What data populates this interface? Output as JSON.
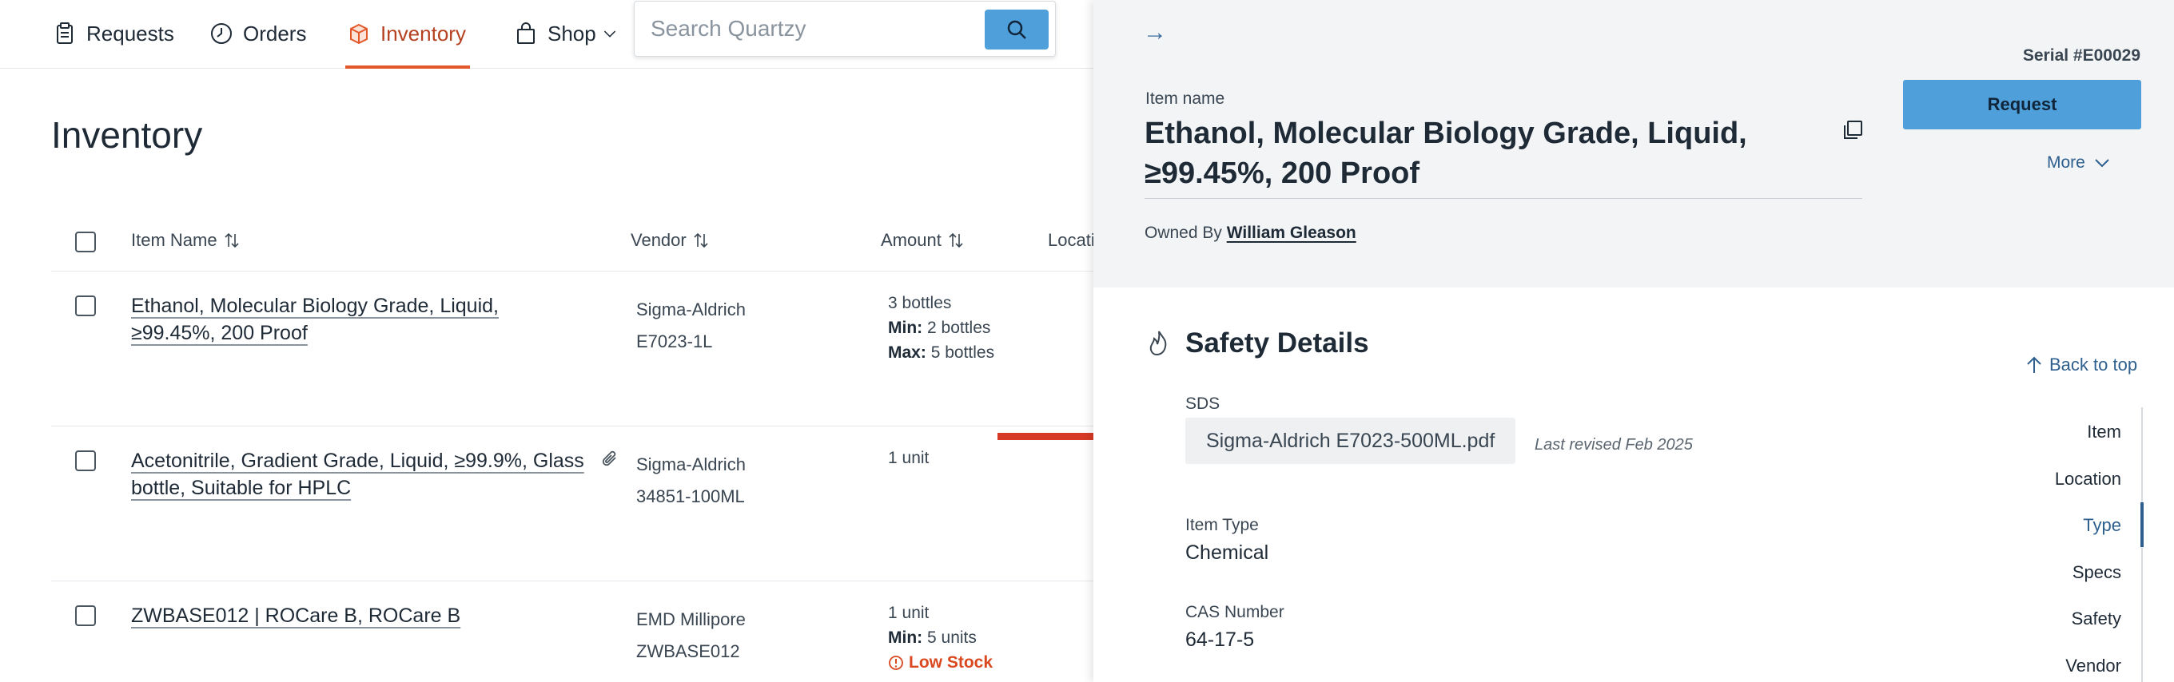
{
  "nav": {
    "items": [
      {
        "label": "Requests",
        "icon": "clipboard-icon"
      },
      {
        "label": "Orders",
        "icon": "clock-icon"
      },
      {
        "label": "Inventory",
        "icon": "box-icon"
      },
      {
        "label": "Shop",
        "icon": "shopping-bag-icon"
      }
    ],
    "active": "Inventory",
    "search_placeholder": "Search Quartzy"
  },
  "page": {
    "title": "Inventory"
  },
  "table": {
    "columns": [
      "Item Name",
      "Vendor",
      "Amount",
      "Locati"
    ],
    "rows": [
      {
        "name": "Ethanol, Molecular Biology Grade, Liquid, ≥99.45%, 200 Proof",
        "vendor": "Sigma-Aldrich",
        "catalog": "E7023-1L",
        "amount": "3 bottles",
        "min_label": "Min:",
        "min": "2 bottles",
        "max_label": "Max:",
        "max": "5 bottles"
      },
      {
        "name": "Acetonitrile, Gradient Grade, Liquid, ≥99.9%, Glass bottle, Suitable for HPLC",
        "vendor": "Sigma-Aldrich",
        "catalog": "34851-100ML",
        "amount": "1 unit",
        "has_attachment": true
      },
      {
        "name": "ZWBASE012 | ROCare B, ROCare B",
        "vendor": "EMD Millipore",
        "catalog": "ZWBASE012",
        "amount": "1 unit",
        "min_label": "Min:",
        "min": "5 units",
        "status": "Low Stock"
      }
    ]
  },
  "panel": {
    "serial": "Serial #E00029",
    "request_label": "Request",
    "more_label": "More",
    "item_name_label": "Item name",
    "item_name": "Ethanol, Molecular Biology Grade, Liquid, ≥99.45%, 200 Proof",
    "owned_by_label": "Owned By",
    "owner": "William Gleason",
    "safety_title": "Safety Details",
    "back_to_top": "Back to top",
    "sds_label": "SDS",
    "sds_file": "Sigma-Aldrich E7023-500ML.pdf",
    "sds_revised": "Last revised Feb 2025",
    "item_type_label": "Item Type",
    "item_type": "Chemical",
    "cas_label": "CAS Number",
    "cas": "64-17-5",
    "toc": [
      "Item",
      "Location",
      "Type",
      "Specs",
      "Safety",
      "Vendor"
    ],
    "toc_active": "Type"
  },
  "colors": {
    "accent_blue": "#4f9fda",
    "active_nav": "#e2582a",
    "low_stock": "#d9481f",
    "arrow": "#d63a26"
  }
}
